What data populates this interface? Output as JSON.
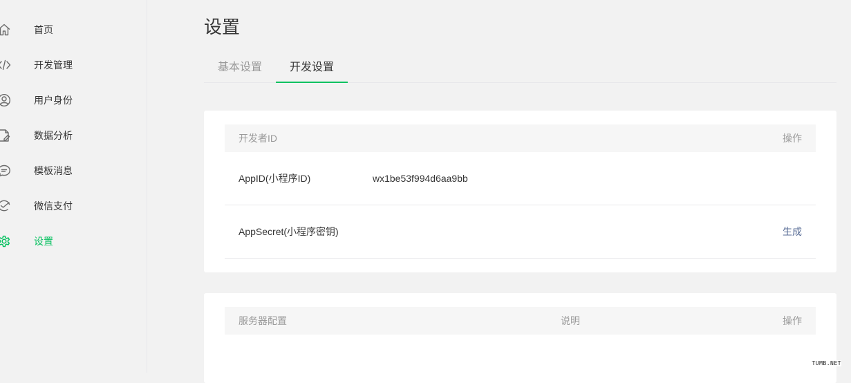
{
  "sidebar": {
    "items": [
      {
        "label": "首页",
        "icon": "home-icon"
      },
      {
        "label": "开发管理",
        "icon": "code-icon"
      },
      {
        "label": "用户身份",
        "icon": "user-icon"
      },
      {
        "label": "数据分析",
        "icon": "document-chart-icon"
      },
      {
        "label": "模板消息",
        "icon": "message-icon"
      },
      {
        "label": "微信支付",
        "icon": "payment-icon"
      },
      {
        "label": "设置",
        "icon": "gear-icon",
        "active": true
      }
    ]
  },
  "page": {
    "title": "设置"
  },
  "tabs": [
    {
      "label": "基本设置",
      "active": false
    },
    {
      "label": "开发设置",
      "active": true
    }
  ],
  "developer_card": {
    "header": {
      "left": "开发者ID",
      "right": "操作"
    },
    "rows": [
      {
        "key": "AppID(小程序ID)",
        "value": "wx1be53f994d6aa9bb",
        "action": ""
      },
      {
        "key": "AppSecret(小程序密钥)",
        "value": "",
        "action": "生成"
      }
    ]
  },
  "server_card": {
    "header": {
      "left": "服务器配置",
      "mid": "说明",
      "right": "操作"
    }
  },
  "watermark": "TUMB.NET",
  "colors": {
    "accent": "#07c160",
    "link": "#576b95",
    "background": "#f2f2f2"
  }
}
